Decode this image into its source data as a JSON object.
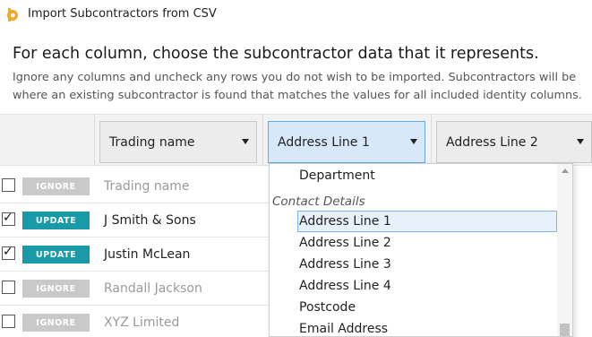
{
  "window": {
    "title": "Import Subcontractors from CSV",
    "icon": "app-logo-icon"
  },
  "heading": "For each column, choose the subcontractor data that it represents.",
  "instructions": [
    "Ignore any columns and uncheck any rows you do not wish to be imported. Subcontractors will be",
    "where an existing subcontractor is found that matches the values for all included identity columns."
  ],
  "columns": [
    {
      "label": "Trading name"
    },
    {
      "label": "Address Line 1"
    },
    {
      "label": "Address Line 2"
    }
  ],
  "rows": [
    {
      "checked": false,
      "status": "IGNORE",
      "name": "Trading name"
    },
    {
      "checked": true,
      "status": "UPDATE",
      "name": "J Smith & Sons"
    },
    {
      "checked": true,
      "status": "UPDATE",
      "name": "Justin McLean"
    },
    {
      "checked": false,
      "status": "IGNORE",
      "name": "Randall Jackson"
    },
    {
      "checked": false,
      "status": "IGNORE",
      "name": "XYZ Limited"
    }
  ],
  "dropdown": {
    "items": [
      {
        "kind": "option",
        "label": "Department"
      },
      {
        "kind": "group",
        "label": "Contact Details"
      },
      {
        "kind": "option",
        "label": "Address Line 1",
        "selected": true
      },
      {
        "kind": "option",
        "label": "Address Line 2"
      },
      {
        "kind": "option",
        "label": "Address Line 3"
      },
      {
        "kind": "option",
        "label": "Address Line 4"
      },
      {
        "kind": "option",
        "label": "Postcode"
      },
      {
        "kind": "option",
        "label": "Email Address"
      }
    ]
  },
  "colors": {
    "update": "#1a9aa8",
    "ignore": "#c9c9c9",
    "active_select": "#d6e8fa",
    "brand": "#f5a623"
  }
}
